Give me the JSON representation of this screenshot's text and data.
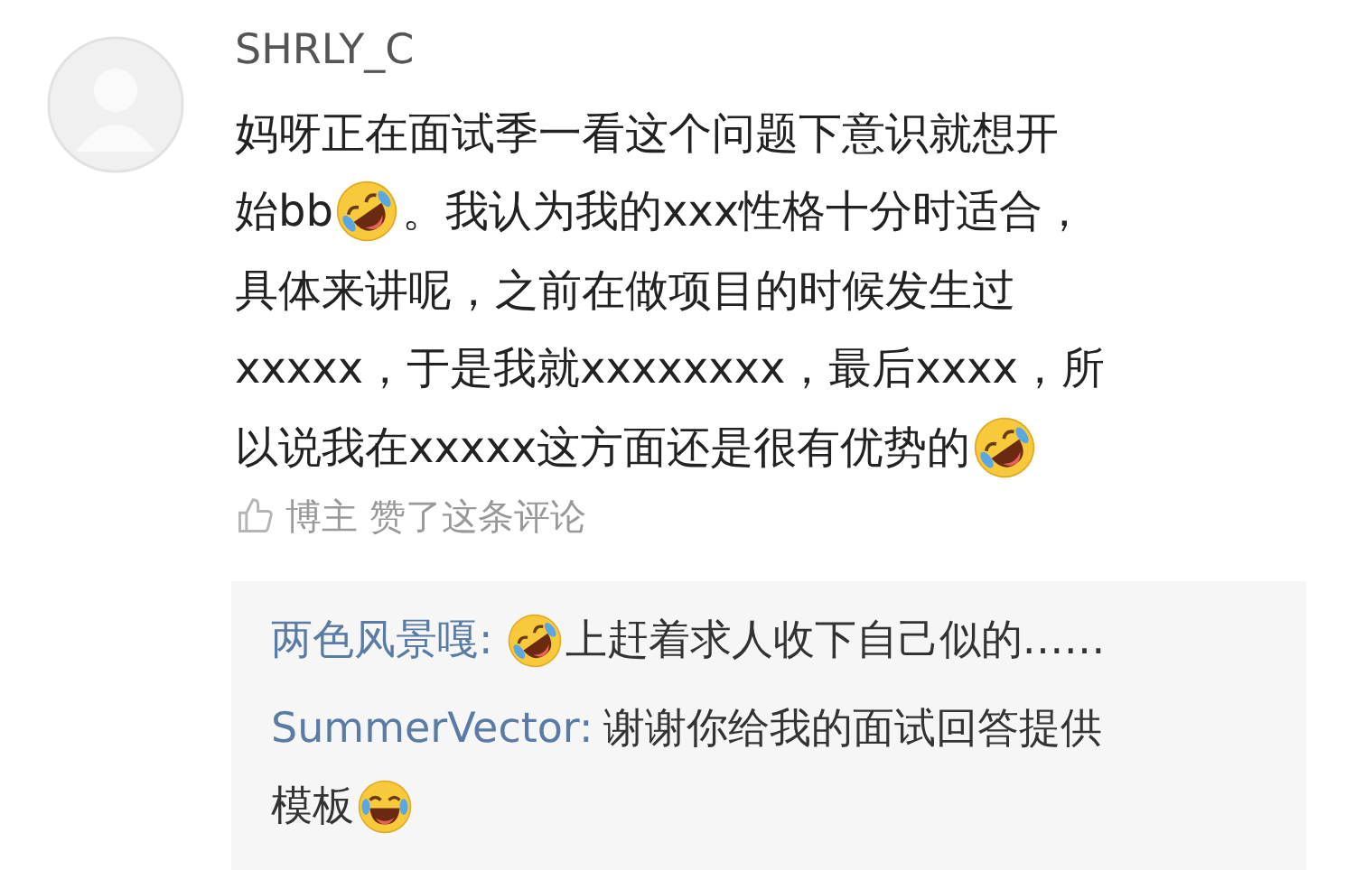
{
  "comment": {
    "author": "SHRLY_C",
    "lines": [
      [
        {
          "kind": "text",
          "text": "妈呀正在面试季一看这个问题下意识就想开"
        }
      ],
      [
        {
          "kind": "text",
          "text": "始bb"
        },
        {
          "kind": "tilted-emoji"
        },
        {
          "kind": "text",
          "text": "。我认为我的xxx性格十分时适合，"
        }
      ],
      [
        {
          "kind": "text",
          "text": "具体来讲呢，之前在做项目的时候发生过"
        }
      ],
      [
        {
          "kind": "text",
          "text": "xxxxx，于是我就xxxxxxxx，最后xxxx，所"
        }
      ],
      [
        {
          "kind": "text",
          "text": "以说我在xxxxx这方面还是很有优势的"
        },
        {
          "kind": "tilted-emoji"
        }
      ]
    ],
    "like_note": "博主 赞了这条评论"
  },
  "replies": [
    {
      "lines": [
        [
          {
            "kind": "author",
            "text": "两色风景嘎:"
          },
          {
            "kind": "tilted-emoji"
          },
          {
            "kind": "text",
            "text": "上赶着求人收下自己似的……"
          }
        ]
      ]
    },
    {
      "lines": [
        [
          {
            "kind": "author",
            "text": "SummerVector:"
          },
          {
            "kind": "text",
            "text": "谢谢你给我的面试回答提供"
          }
        ],
        [
          {
            "kind": "text",
            "text": "模板"
          },
          {
            "kind": "emoji"
          }
        ]
      ]
    }
  ]
}
